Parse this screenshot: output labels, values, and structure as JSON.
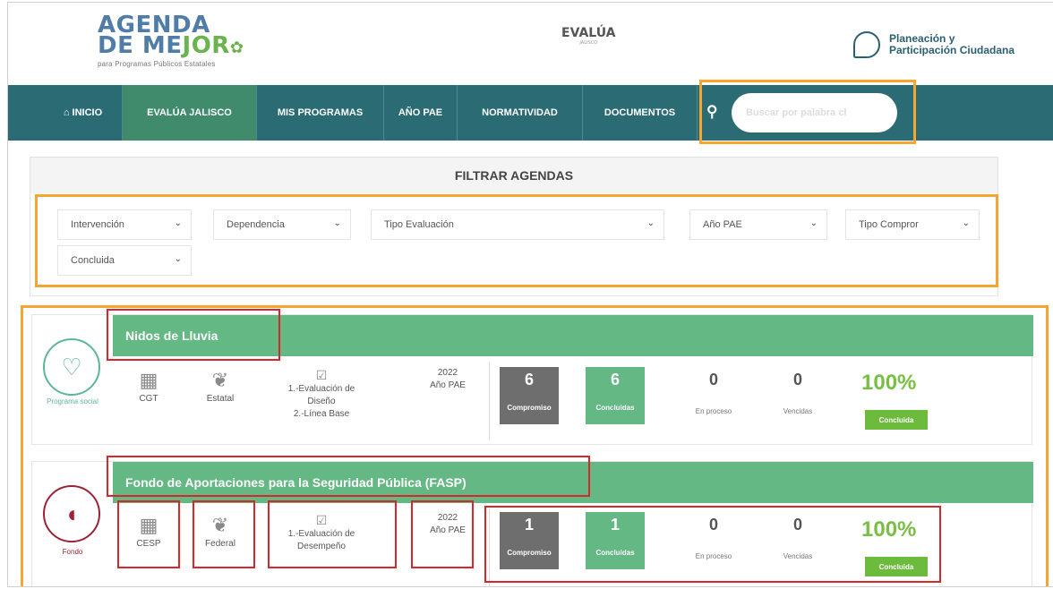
{
  "header": {
    "logo_line1": "AGENDA",
    "logo_line2a": "DE ME",
    "logo_line2b": "JOR",
    "logo_sub": "para Programas Públicos Estatales",
    "brand": "EVALÚA",
    "brand_sub": "JALISCO",
    "planeacion_line1": "Planeación y",
    "planeacion_line2": "Participación Ciudadana"
  },
  "nav": {
    "items": [
      {
        "label": "INICIO",
        "icon": "home-icon"
      },
      {
        "label": "EVALÚA JALISCO"
      },
      {
        "label": "MIS PROGRAMAS"
      },
      {
        "label": "AÑO PAE"
      },
      {
        "label": "NORMATIVIDAD"
      },
      {
        "label": "DOCUMENTOS"
      }
    ],
    "search_placeholder": "Buscar por palabra cl"
  },
  "filters": {
    "title": "FILTRAR AGENDAS",
    "selects": [
      "Intervención",
      "Dependencia",
      "Tipo Evaluación",
      "Año PAE",
      "Tipo Compror",
      "Concluida"
    ]
  },
  "agendas": [
    {
      "name": "Nidos de Lluvia",
      "type": "Programa social",
      "dependencia": "CGT",
      "orden": "Estatal",
      "evaluacion": [
        "1.-Evaluación de",
        "Diseño",
        "2.-Línea Base"
      ],
      "year": "2022",
      "year_label": "Año PAE",
      "compromiso": "6",
      "compromiso_label": "Compromiso",
      "concluidas": "6",
      "concluidas_label": "Concluidas",
      "en_proceso": "0",
      "en_proceso_label": "En proceso",
      "vencidas": "0",
      "vencidas_label": "Vencidas",
      "percent": "100%",
      "status": "Concluida",
      "color": "#5bb79a"
    },
    {
      "name": "Fondo de Aportaciones para la Seguridad Pública (FASP)",
      "type": "Fondo",
      "dependencia": "CESP",
      "orden": "Federal",
      "evaluacion": [
        "1.-Evaluación de",
        "Desempeño"
      ],
      "year": "2022",
      "year_label": "Año PAE",
      "compromiso": "1",
      "compromiso_label": "Compromiso",
      "concluidas": "1",
      "concluidas_label": "Concluidas",
      "en_proceso": "0",
      "en_proceso_label": "En proceso",
      "vencidas": "0",
      "vencidas_label": "Vencidas",
      "percent": "100%",
      "status": "Concluida",
      "color": "#9b2335"
    }
  ],
  "colors": {
    "nav": "#2b6b74",
    "nav_active": "#3f8b6b",
    "card_bar": "#64b883",
    "highlight_orange": "#f7a531",
    "highlight_red": "#d6282c",
    "percent": "#78bf43"
  }
}
